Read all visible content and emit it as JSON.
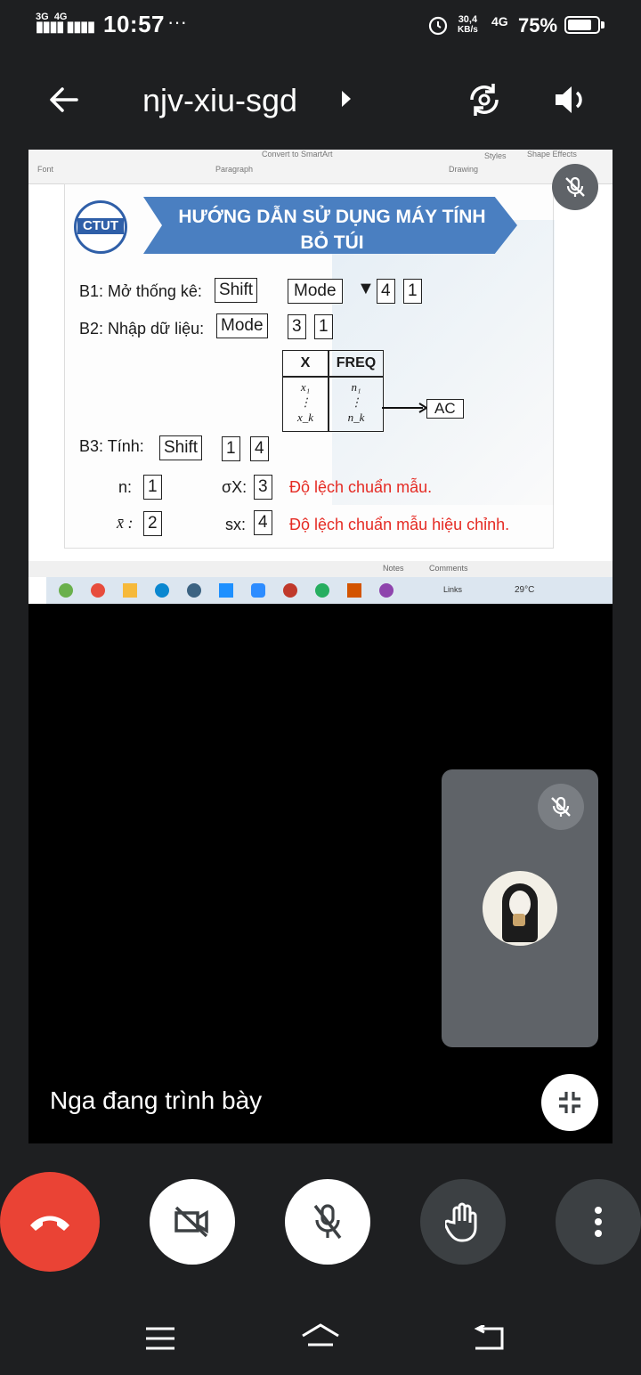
{
  "status_bar": {
    "network_1": "3G",
    "network_2": "4G",
    "time": "10:57",
    "dots": "···",
    "speed_value": "30,4",
    "speed_unit": "KB/s",
    "net_type": "4G",
    "battery": "75%"
  },
  "header": {
    "meeting_code": "njv-xiu-sgd",
    "back_icon": "arrow-left-icon",
    "switch_camera_icon": "camera-switch-icon",
    "audio_icon": "speaker-icon"
  },
  "shared_screen": {
    "ribbon": {
      "font_group": "Font",
      "paragraph_group": "Paragraph",
      "drawing_group": "Drawing",
      "convert_smartart": "Convert to SmartArt",
      "styles": "Styles",
      "shape_effects": "Shape Effects"
    },
    "slide": {
      "logo": "CTUT",
      "title_line1": "HƯỚNG DẪN SỬ DỤNG MÁY TÍNH",
      "title_line2": "BỎ TÚI",
      "b1_label": "B1: Mở thống kê:",
      "b1_keys": [
        "Shift",
        "Mode",
        "▼",
        "4",
        "1"
      ],
      "b2_label": "B2: Nhập dữ liệu:",
      "b2_keys": [
        "Mode",
        "3",
        "1"
      ],
      "table_headers": [
        "X",
        "FREQ"
      ],
      "table_col1": [
        "x₁",
        "⋮",
        "x_k"
      ],
      "table_col2": [
        "n₁",
        "⋮",
        "n_k"
      ],
      "ac_key": "AC",
      "b3_label": "B3: Tính:",
      "b3_keys": [
        "Shift",
        "1",
        "4"
      ],
      "n_label": "n:",
      "n_key": "1",
      "sigma_label": "σX:",
      "sigma_key": "3",
      "sigma_desc": "Độ lệch chuẩn mẫu.",
      "mean_label": "x̄ :",
      "mean_key": "2",
      "sx_label": "sx:",
      "sx_key": "4",
      "sx_desc": "Độ lệch chuẩn mẫu hiệu chỉnh."
    },
    "notes_bar": {
      "notes": "Notes",
      "comments": "Comments"
    },
    "taskbar": {
      "links": "Links",
      "temperature": "29°C"
    }
  },
  "presenter_status": "Nga đang trình bày",
  "controls": {
    "end_call": "end-call-icon",
    "camera_off": "camera-off-icon",
    "mic_off": "mic-off-icon",
    "raise_hand": "raise-hand-icon",
    "more": "more-vert-icon"
  },
  "colors": {
    "end_call": "#ea4335",
    "control_bg": "#3c4043",
    "active_control_bg": "#ffffff",
    "tile_bg": "#5f6368",
    "slide_title_banner": "#4a7fc1",
    "slide_red_text": "#e52b24"
  }
}
